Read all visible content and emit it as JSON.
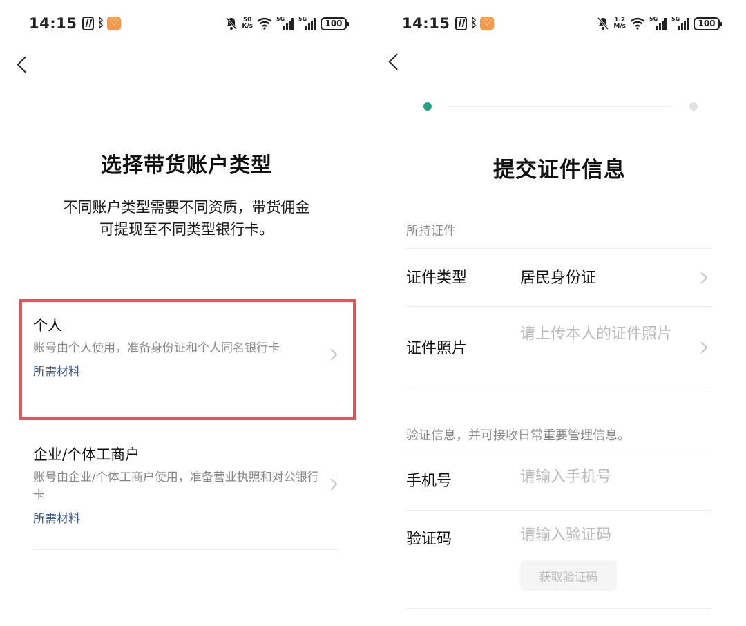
{
  "left": {
    "status_bar": {
      "time": "14:15",
      "speed_value": "50",
      "speed_unit": "K/s",
      "net_tag": "5G",
      "battery": "100"
    },
    "title": "选择带货账户类型",
    "subtitle": [
      "不同账户类型需要不同资质，带货佣金",
      "可提现至不同类型银行卡。"
    ],
    "options": [
      {
        "name": "个人",
        "description": "账号由个人使用，准备身份证和个人同名银行卡",
        "link": "所需材料",
        "highlighted": true
      },
      {
        "name": "企业/个体工商户",
        "description": "账号由企业/个体工商户使用，准备营业执照和对公银行卡",
        "link": "所需材料",
        "highlighted": false
      }
    ]
  },
  "right": {
    "status_bar": {
      "time": "14:15",
      "speed_value": "1.2",
      "speed_unit": "M/s",
      "net_tag": "5G",
      "battery": "100"
    },
    "title": "提交证件信息",
    "section_id_label": "所持证件",
    "id_type": {
      "label": "证件类型",
      "value": "居民身份证"
    },
    "id_photo": {
      "label": "证件照片",
      "placeholder": "请上传本人的证件照片"
    },
    "section_verify_label": "验证信息，并可接收日常重要管理信息。",
    "phone": {
      "label": "手机号",
      "placeholder": "请输入手机号"
    },
    "code": {
      "label": "验证码",
      "placeholder": "请输入验证码",
      "button": "获取验证码"
    }
  },
  "colors": {
    "accent": "#22a389",
    "highlight_border": "#e05757",
    "link": "#3d5a8c"
  }
}
